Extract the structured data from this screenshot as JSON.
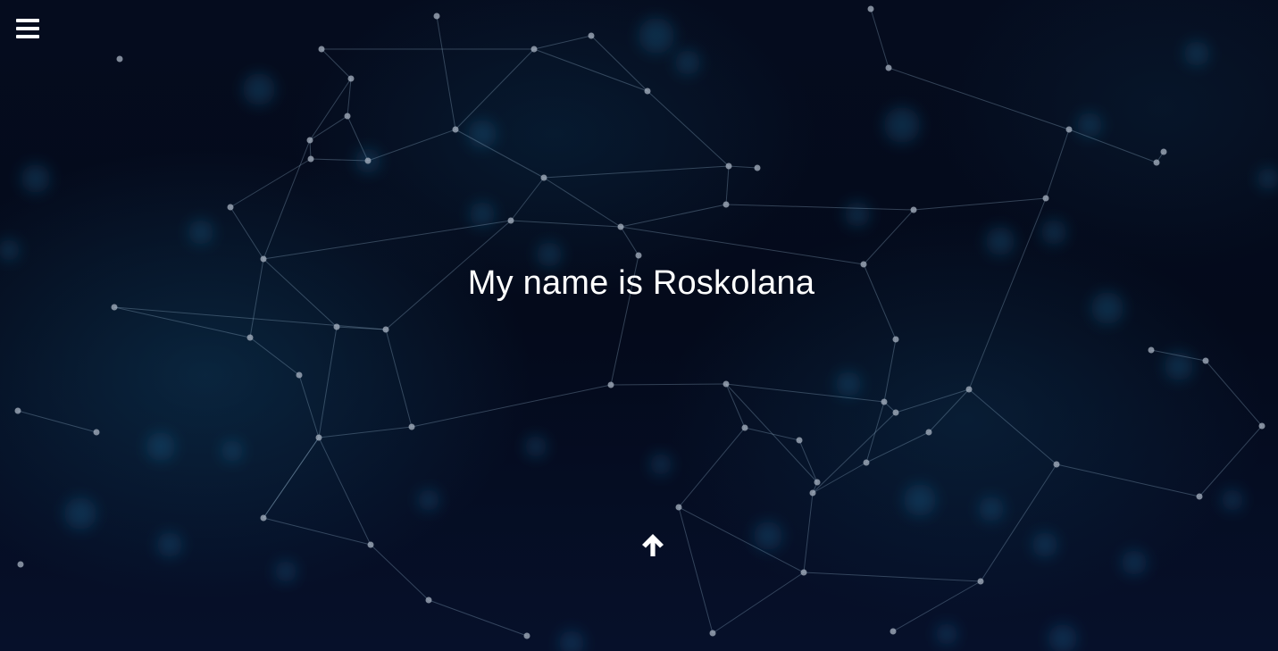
{
  "header": {
    "menu_icon": "hamburger-menu-icon"
  },
  "hero": {
    "headline": "My name is Roskolana"
  },
  "scroll_button": {
    "icon": "arrow-up-icon"
  },
  "colors": {
    "background": "#04091a",
    "text": "#ffffff",
    "network_lines": "#96b4cd",
    "network_glow": "#2878aa"
  }
}
